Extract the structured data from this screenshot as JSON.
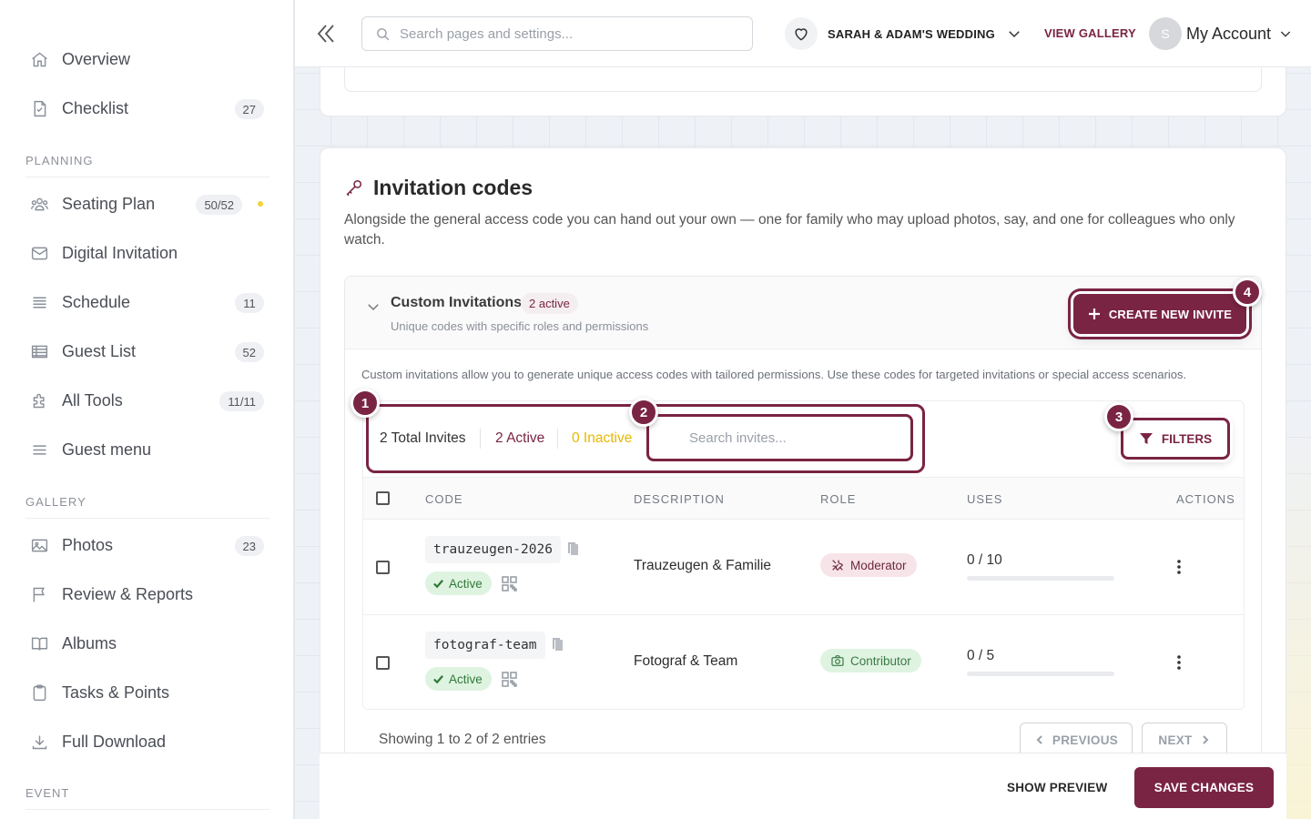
{
  "sidebar": {
    "top_items": [
      {
        "label": "Overview",
        "icon": "home-icon"
      },
      {
        "label": "Checklist",
        "icon": "checklist-icon",
        "badge": "27"
      }
    ],
    "sections": {
      "planning": "PLANNING",
      "gallery": "GALLERY",
      "event": "EVENT"
    },
    "planning_items": [
      {
        "label": "Seating Plan",
        "icon": "people-icon",
        "badge": "50/52",
        "dot": true
      },
      {
        "label": "Digital Invitation",
        "icon": "envelope-icon"
      },
      {
        "label": "Schedule",
        "icon": "schedule-icon",
        "badge": "11"
      },
      {
        "label": "Guest List",
        "icon": "table-icon",
        "badge": "52"
      },
      {
        "label": "All Tools",
        "icon": "puzzle-icon",
        "badge": "11/11"
      },
      {
        "label": "Guest menu",
        "icon": "menu-icon"
      }
    ],
    "gallery_items": [
      {
        "label": "Photos",
        "icon": "image-icon",
        "badge": "23"
      },
      {
        "label": "Review & Reports",
        "icon": "flag-icon"
      },
      {
        "label": "Albums",
        "icon": "book-icon"
      },
      {
        "label": "Tasks & Points",
        "icon": "clipboard-icon"
      },
      {
        "label": "Full Download",
        "icon": "download-icon"
      }
    ]
  },
  "topbar": {
    "search_placeholder": "Search pages and settings...",
    "event_name": "SARAH & ADAM'S WEDDING",
    "view_gallery": "VIEW GALLERY",
    "avatar_initial": "S",
    "account_label": "My Account"
  },
  "invitation_codes": {
    "title": "Invitation codes",
    "description": "Alongside the general access code you can hand out your own — one for family who may upload photos, say, and one for colleagues who only watch.",
    "panel": {
      "title": "Custom Invitations",
      "active_badge": "2 active",
      "subtitle": "Unique codes with specific roles and permissions",
      "create_button": "CREATE NEW INVITE",
      "info": "Custom invitations allow you to generate unique access codes with tailored permissions. Use these codes for targeted invitations or special access scenarios."
    },
    "stats": {
      "total": "2 Total Invites",
      "active": "2 Active",
      "inactive": "0 Inactive"
    },
    "search_placeholder": "Search invites...",
    "filters_button": "FILTERS",
    "columns": {
      "code": "CODE",
      "description": "DESCRIPTION",
      "role": "ROLE",
      "uses": "USES",
      "actions": "ACTIONS"
    },
    "rows": [
      {
        "code": "trauzeugen-2026",
        "status": "Active",
        "description": "Trauzeugen & Familie",
        "role": "Moderator",
        "uses": "0 / 10",
        "uses_fraction": 0
      },
      {
        "code": "fotograf-team",
        "status": "Active",
        "description": "Fotograf & Team",
        "role": "Contributor",
        "uses": "0 / 5",
        "uses_fraction": 0
      }
    ],
    "showing": "Showing 1 to 2 of 2 entries",
    "previous": "PREVIOUS",
    "next": "NEXT"
  },
  "markers": [
    "1",
    "2",
    "3",
    "4"
  ],
  "bottom_bar": {
    "show_preview": "SHOW PREVIEW",
    "save_changes": "SAVE CHANGES"
  },
  "colors": {
    "accent": "#7a2444",
    "inactive": "#e6b800",
    "active_green": "#2f7a38"
  }
}
